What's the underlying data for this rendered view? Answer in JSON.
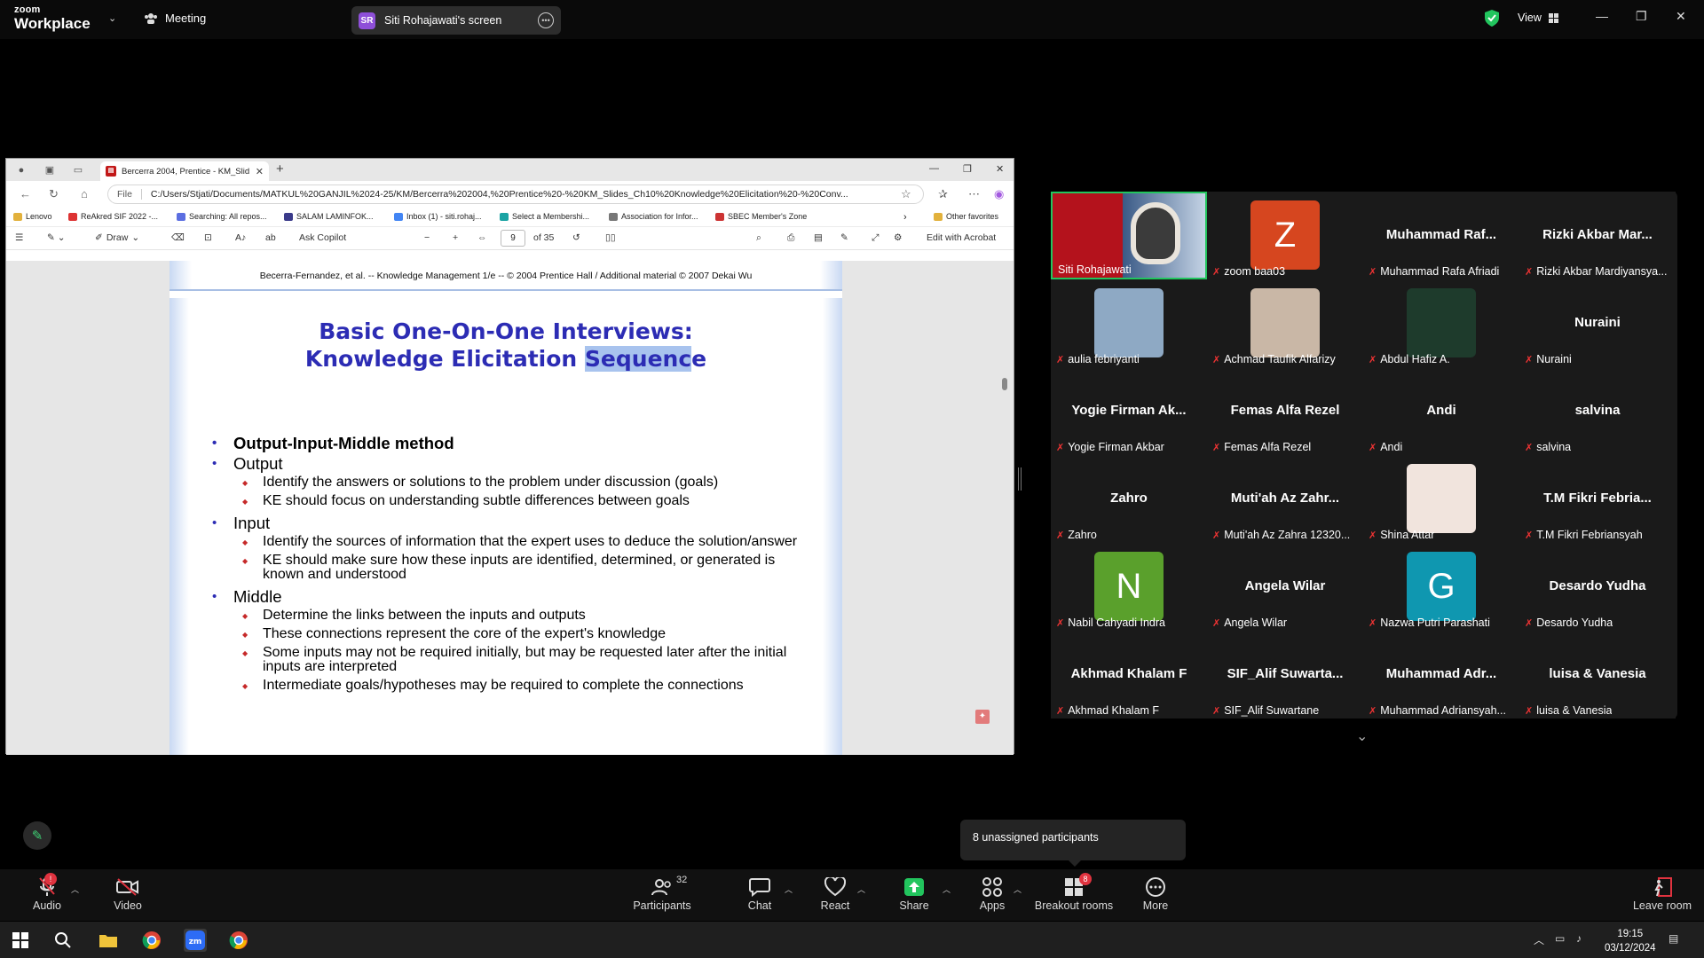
{
  "app": {
    "logo_line1": "zoom",
    "logo_line2": "Workplace",
    "meeting_label": "Meeting",
    "share_badge": "SR",
    "share_label": "Siti Rohajawati's screen",
    "view_label": "View"
  },
  "browser": {
    "tab_title": "Bercerra 2004, Prentice - KM_Slid",
    "file_label": "File",
    "url": "C:/Users/Stjati/Documents/MATKUL%20GANJIL%2024-25/KM/Bercerra%202004,%20Prentice%20-%20KM_Slides_Ch10%20Knowledge%20Elicitation%20-%20Conv...",
    "favorites": [
      {
        "label": "Lenovo",
        "color": "#e2b13c"
      },
      {
        "label": "ReAkred SIF 2022 -...",
        "color": "#d33"
      },
      {
        "label": "Searching: All repos...",
        "color": "#5b6ee1"
      },
      {
        "label": "SALAM LAMINFOK...",
        "color": "#3a3a8a"
      },
      {
        "label": "Inbox (1) - siti.rohaj...",
        "color": "#4285f4"
      },
      {
        "label": "Select a Membershi...",
        "color": "#1aa3a3"
      },
      {
        "label": "Association for Infor...",
        "color": "#777"
      },
      {
        "label": "SBEC Member's Zone",
        "color": "#c33"
      }
    ],
    "other_favorites": "Other favorites"
  },
  "pdf_toolbar": {
    "draw_label": "Draw",
    "copilot_label": "Ask Copilot",
    "page_current": "9",
    "page_total": "of 35",
    "acrobat_label": "Edit with Acrobat"
  },
  "slide": {
    "header": "Becerra-Fernandez, et al. -- Knowledge Management 1/e  --  © 2004 Prentice Hall / Additional material © 2007 Dekai Wu",
    "title_line1": "Basic One-On-One Interviews:",
    "title_line2_pre": "Knowledge Elicitation ",
    "title_line2_hl": "Sequenc",
    "title_line2_post": "e",
    "method": "Output-Input-Middle method",
    "output_label": "Output",
    "output_items": [
      "Identify the answers or solutions to the problem under discussion (goals)",
      "KE should focus on understanding subtle differences between goals"
    ],
    "input_label": "Input",
    "input_items": [
      "Identify the sources of information that the expert uses to deduce the solution/answer",
      "KE should make sure how these inputs are identified, determined, or generated is known and understood"
    ],
    "middle_label": "Middle",
    "middle_items": [
      "Determine the links between the inputs and outputs",
      "These connections represent the core of the expert's knowledge",
      "Some inputs may not be required initially, but may be requested later after the initial inputs are interpreted",
      "Intermediate goals/hypotheses may be required to complete the connections"
    ]
  },
  "participants": [
    {
      "big": "",
      "label": "Siti Rohajawati",
      "muted": false,
      "avatar": "video",
      "active": true
    },
    {
      "big": "",
      "label": "zoom baa03",
      "muted": true,
      "avatar": "Z",
      "avatar_color": "#d6461f"
    },
    {
      "big": "Muhammad  Raf...",
      "label": "Muhammad Rafa Afriadi",
      "muted": true
    },
    {
      "big": "Rizki  Akbar  Mar...",
      "label": "Rizki Akbar Mardiyansya...",
      "muted": true
    },
    {
      "big": "",
      "label": "aulia febriyanti",
      "muted": true,
      "avatar": "photo",
      "avatar_color": "#8ea9c4"
    },
    {
      "big": "",
      "label": "Achmad Taufik Alfarizy",
      "muted": true,
      "avatar": "photo",
      "avatar_color": "#c9b7a6"
    },
    {
      "big": "",
      "label": "Abdul Hafiz A.",
      "muted": true,
      "avatar": "photo",
      "avatar_color": "#1e3b2c"
    },
    {
      "big": "Nuraini",
      "label": "Nuraini",
      "muted": true
    },
    {
      "big": "Yogie  Firman  Ak...",
      "label": "Yogie Firman Akbar",
      "muted": true
    },
    {
      "big": "Femas  Alfa  Rezel",
      "label": "Femas Alfa Rezel",
      "muted": true
    },
    {
      "big": "Andi",
      "label": "Andi",
      "muted": true
    },
    {
      "big": "salvina",
      "label": "salvina",
      "muted": true
    },
    {
      "big": "Zahro",
      "label": "Zahro",
      "muted": true
    },
    {
      "big": "Muti'ah  Az  Zahr...",
      "label": "Muti'ah Az Zahra 12320...",
      "muted": true
    },
    {
      "big": "",
      "label": "Shina Attar",
      "muted": true,
      "avatar": "photo",
      "avatar_color": "#f1e4dd"
    },
    {
      "big": "T.M  Fikri  Febria...",
      "label": "T.M Fikri Febriansyah",
      "muted": true
    },
    {
      "big": "",
      "label": "Nabil Cahyadi Indra",
      "muted": true,
      "avatar": "N",
      "avatar_color": "#5aa02c"
    },
    {
      "big": "Angela  Wilar",
      "label": "Angela Wilar",
      "muted": true
    },
    {
      "big": "",
      "label": "Nazwa Putri Parashati",
      "muted": true,
      "avatar": "G",
      "avatar_color": "#0f97b0"
    },
    {
      "big": "Desardo  Yudha",
      "label": "Desardo Yudha",
      "muted": true
    },
    {
      "big": "Akhmad  Khalam  F",
      "label": "Akhmad Khalam F",
      "muted": true
    },
    {
      "big": "SIF_Alif  Suwarta...",
      "label": "SIF_Alif Suwartane",
      "muted": true
    },
    {
      "big": "Muhammad  Adr...",
      "label": "Muhammad Adriansyah...",
      "muted": true
    },
    {
      "big": "luisa  &  Vanesia",
      "label": "luisa & Vanesia",
      "muted": true
    }
  ],
  "unassigned": "8 unassigned participants",
  "toolbar": {
    "audio": "Audio",
    "video": "Video",
    "participants": "Participants",
    "participants_count": "32",
    "chat": "Chat",
    "react": "React",
    "share": "Share",
    "apps": "Apps",
    "breakout": "Breakout rooms",
    "breakout_badge": "8",
    "more": "More",
    "leave": "Leave room"
  },
  "taskbar": {
    "time": "19:15",
    "date": "03/12/2024"
  },
  "colors": {
    "accent_green": "#22c55e",
    "slide_title": "#2c2cb4",
    "share_green": "#22c55e",
    "mute_red": "#e33333"
  }
}
